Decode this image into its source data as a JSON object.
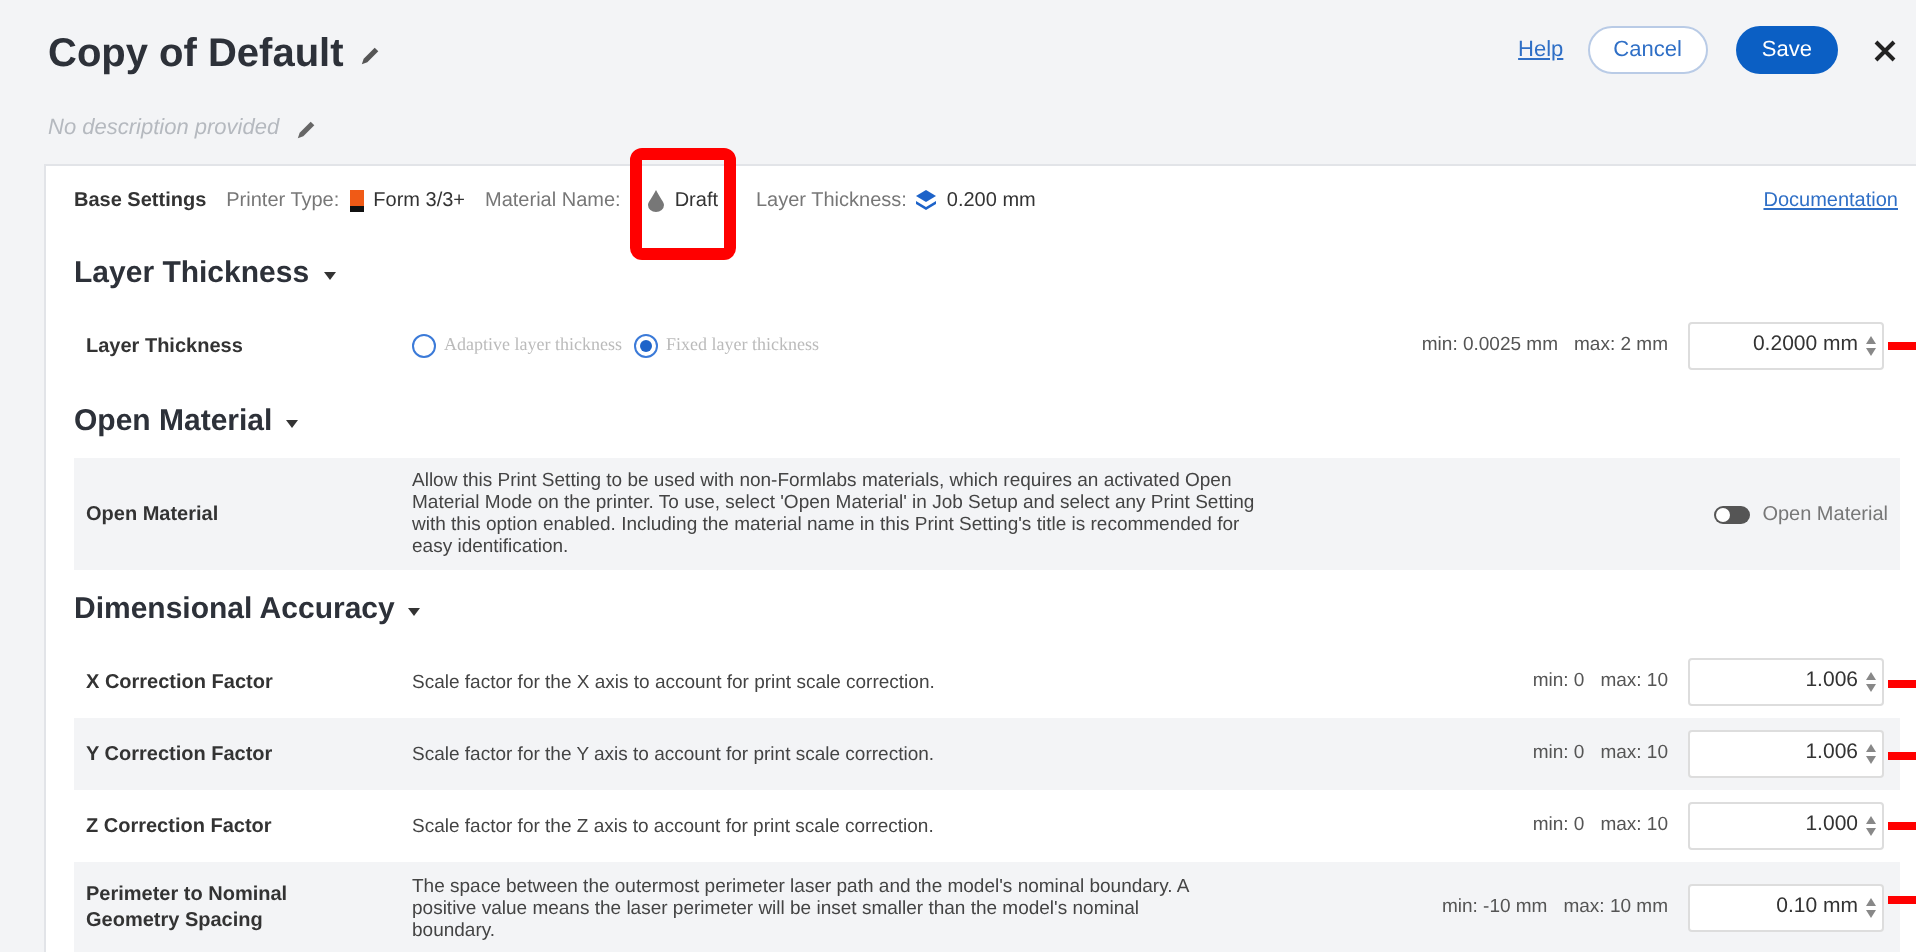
{
  "header": {
    "title": "Copy of Default",
    "description": "No description provided",
    "help_link": "Help",
    "cancel_button": "Cancel",
    "save_button": "Save"
  },
  "base_settings": {
    "label": "Base Settings",
    "items": [
      {
        "label": "Printer Type:",
        "value": "Form 3/3+",
        "kind": "printer"
      },
      {
        "label": "Material Name:",
        "value": "Draft",
        "kind": "drop"
      },
      {
        "label": "Layer Thickness:",
        "value": "0.200 mm",
        "kind": "layers"
      }
    ],
    "documentation_link": "Documentation"
  },
  "sections": [
    {
      "title": "Layer Thickness",
      "expanded": true,
      "rows": [
        {
          "kind": "radio",
          "label": "Layer Thickness",
          "highlighted": false,
          "options": [
            {
              "label": "Adaptive layer thickness",
              "selected": false
            },
            {
              "label": "Fixed layer thickness",
              "selected": true
            }
          ],
          "min": "min: 0.0025 mm",
          "max": "max: 2 mm",
          "value": "0.2000 mm"
        }
      ]
    },
    {
      "title": "Open Material",
      "expanded": true,
      "rows": [
        {
          "kind": "toggle",
          "label": "Open Material",
          "highlighted": true,
          "description": "Allow this Print Setting to be used with non-Formlabs materials, which requires an activated Open Material Mode on the printer. To use, select 'Open Material' in Job Setup and select any Print Setting with this option enabled. Including the material name in this Print Setting's title is recommended for easy identification.",
          "toggle": {
            "label": "Open Material",
            "on": false
          }
        }
      ]
    },
    {
      "title": "Dimensional Accuracy",
      "expanded": true,
      "rows": [
        {
          "kind": "number",
          "label": "X Correction Factor",
          "highlighted": false,
          "description": "Scale factor for the X axis to account for print scale correction.",
          "min": "min: 0",
          "max": "max: 10",
          "value": "1.006"
        },
        {
          "kind": "number",
          "label": "Y Correction Factor",
          "highlighted": true,
          "description": "Scale factor for the Y axis to account for print scale correction.",
          "min": "min: 0",
          "max": "max: 10",
          "value": "1.006"
        },
        {
          "kind": "number",
          "label": "Z Correction Factor",
          "highlighted": false,
          "description": "Scale factor for the Z axis to account for print scale correction.",
          "min": "min: 0",
          "max": "max: 10",
          "value": "1.000"
        },
        {
          "kind": "number",
          "label": "Perimeter to Nominal Geometry Spacing",
          "highlighted": true,
          "description": "The space between the outermost perimeter laser path and the model's nominal boundary. A positive value means the laser perimeter will be inset smaller than the model's nominal boundary.",
          "min": "min: -10 mm",
          "max": "max: 10 mm",
          "value": "0.10 mm"
        }
      ]
    }
  ]
}
